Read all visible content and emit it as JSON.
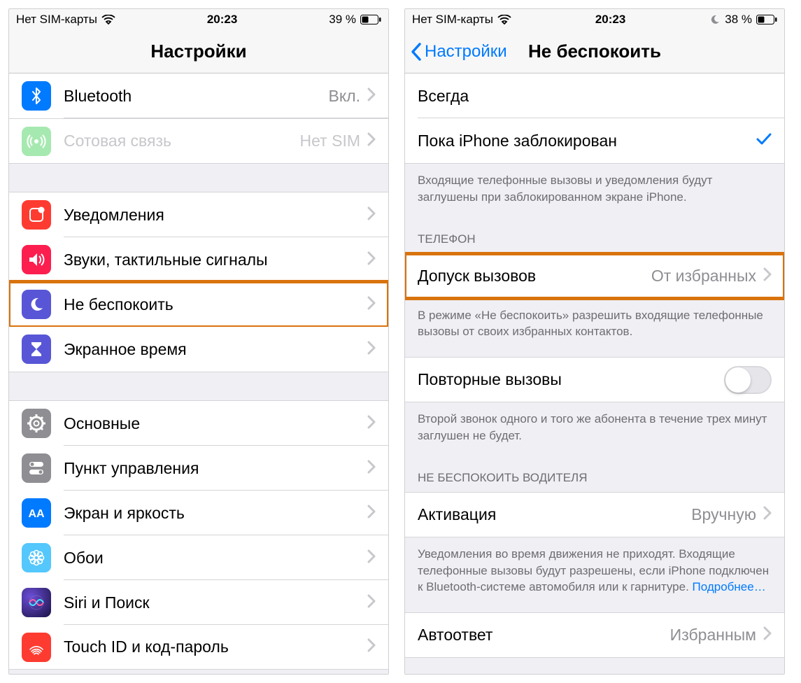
{
  "left": {
    "status": {
      "carrier": "Нет SIM-карты",
      "time": "20:23",
      "battery": "39 %"
    },
    "nav": {
      "title": "Настройки"
    },
    "groups": [
      {
        "cells": [
          {
            "key": "bluetooth",
            "label": "Bluetooth",
            "value": "Вкл.",
            "icon": "bluetooth",
            "color": "#007aff",
            "chevron": true
          },
          {
            "key": "cellular",
            "label": "Сотовая связь",
            "value": "Нет SIM",
            "icon": "cellular",
            "color": "#4cd964off",
            "chevron": true,
            "disabled": true
          }
        ]
      },
      {
        "cells": [
          {
            "key": "notifications",
            "label": "Уведомления",
            "icon": "notifications",
            "color": "#fe3b30",
            "style": "square",
            "chevron": true
          },
          {
            "key": "sounds",
            "label": "Звуки, тактильные сигналы",
            "icon": "sounds",
            "color": "#fc1e4f",
            "chevron": true
          },
          {
            "key": "dnd",
            "label": "Не беспокоить",
            "icon": "moon",
            "color": "#5856d6",
            "chevron": true,
            "highlight": true
          },
          {
            "key": "screentime",
            "label": "Экранное время",
            "icon": "hourglass",
            "color": "#5856d6",
            "chevron": true
          }
        ]
      },
      {
        "cells": [
          {
            "key": "general",
            "label": "Основные",
            "icon": "gear",
            "color": "#8e8e93",
            "chevron": true
          },
          {
            "key": "controlcenter",
            "label": "Пункт управления",
            "icon": "switches",
            "color": "#8e8e93",
            "chevron": true
          },
          {
            "key": "display",
            "label": "Экран и яркость",
            "icon": "display",
            "color": "#007aff",
            "chevron": true
          },
          {
            "key": "wallpaper",
            "label": "Обои",
            "icon": "flower",
            "color": "#54c7fc",
            "chevron": true
          },
          {
            "key": "siri",
            "label": "Siri и Поиск",
            "icon": "siri",
            "color": "#000000",
            "chevron": true
          },
          {
            "key": "touchid",
            "label": "Touch ID и код-пароль",
            "icon": "fingerprint",
            "color": "#fe3b30",
            "chevron": true
          }
        ]
      }
    ]
  },
  "right": {
    "status": {
      "carrier": "Нет SIM-карты",
      "time": "20:23",
      "battery": "38 %"
    },
    "nav": {
      "back": "Настройки",
      "title": "Не беспокоить"
    },
    "groups": [
      {
        "cells": [
          {
            "key": "always",
            "label": "Всегда"
          },
          {
            "key": "locked",
            "label": "Пока iPhone заблокирован",
            "check": true
          }
        ],
        "footer": "Входящие телефонные вызовы и уведомления будут заглушены при заблокированном экране iPhone."
      },
      {
        "header": "ТЕЛЕФОН",
        "cells": [
          {
            "key": "allowcalls",
            "label": "Допуск вызовов",
            "value": "От избранных",
            "chevron": true,
            "highlight": true
          }
        ],
        "footer": "В режиме «Не беспокоить» разрешить входящие телефонные вызовы от своих избранных контактов."
      },
      {
        "cells": [
          {
            "key": "repeated",
            "label": "Повторные вызовы",
            "toggle": false
          }
        ],
        "footer": "Второй звонок одного и того же абонента в течение трех минут заглушен не будет."
      },
      {
        "header": "НЕ БЕСПОКОИТЬ ВОДИТЕЛЯ",
        "cells": [
          {
            "key": "activate",
            "label": "Активация",
            "value": "Вручную",
            "chevron": true
          }
        ],
        "footer": "Уведомления во время движения не приходят. Входящие телефонные вызовы будут разрешены, если iPhone подключен к Bluetooth-системе автомобиля или к гарнитуре.",
        "footerLink": "Подробнее…"
      },
      {
        "cells": [
          {
            "key": "autoreply",
            "label": "Автоответ",
            "value": "Избранным",
            "chevron": true
          }
        ]
      }
    ]
  },
  "icons": {
    "bluetooth": "bluetooth-icon",
    "cellular": "cellular-icon",
    "notifications": "notifications-icon",
    "sounds": "sounds-icon",
    "moon": "moon-icon",
    "hourglass": "hourglass-icon",
    "gear": "gear-icon",
    "switches": "switches-icon",
    "display": "display-icon",
    "flower": "flower-icon",
    "siri": "siri-icon",
    "fingerprint": "fingerprint-icon"
  }
}
